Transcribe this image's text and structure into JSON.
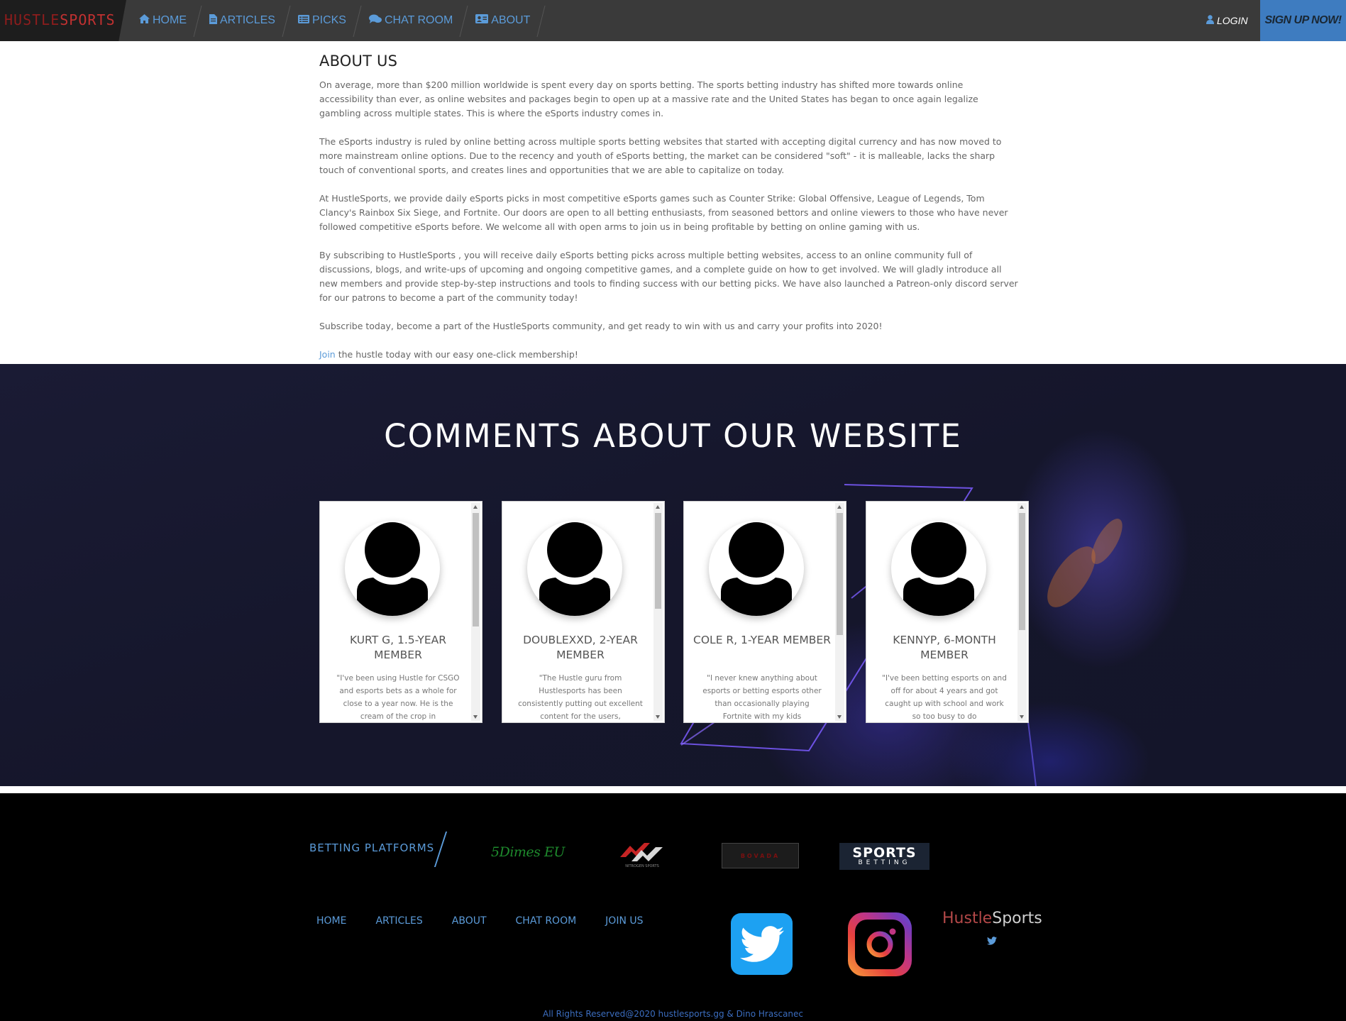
{
  "nav": {
    "brand_part1": "HUSTLE",
    "brand_part2": "SPORTS",
    "items": [
      {
        "label": "HOME",
        "icon": "home-icon"
      },
      {
        "label": "ARTICLES",
        "icon": "file-icon"
      },
      {
        "label": "PICKS",
        "icon": "list-icon"
      },
      {
        "label": "CHAT ROOM",
        "icon": "chat-icon"
      },
      {
        "label": "ABOUT",
        "icon": "id-card-icon"
      }
    ],
    "login_label": "LOGIN",
    "signup_label": "SIGN UP NOW!"
  },
  "about": {
    "title": "ABOUT US",
    "paragraphs": [
      "On average, more than $200 million worldwide is spent every day on sports betting. The sports betting industry has shifted more towards online accessibility than ever, as online websites and packages begin to open up at a massive rate and the United States has began to once again legalize gambling across multiple states. This is where the eSports industry comes in.",
      "The eSports industry is ruled by online betting across multiple sports betting websites that started with accepting digital currency and has now moved to more mainstream online options. Due to the recency and youth of eSports betting, the market can be considered \"soft\" - it is malleable, lacks the sharp touch of conventional sports, and creates lines and opportunities that we are able to capitalize on today.",
      "At HustleSports, we provide daily eSports picks in most competitive eSports games such as Counter Strike: Global Offensive, League of Legends, Tom Clancy's Rainbox Six Siege, and Fortnite. Our doors are open to all betting enthusiasts, from seasoned bettors and online viewers to those who have never followed competitive eSports before. We welcome all with open arms to join us in being profitable by betting on online gaming with us.",
      "By subscribing to HustleSports , you will receive daily eSports betting picks across multiple betting websites, access to an online community full of discussions, blogs, and write-ups of upcoming and ongoing competitive games, and a complete guide on how to get involved. We will gladly introduce all new members and provide step-by-step instructions and tools to finding success with our betting picks. We have also launched a Patreon-only discord server for our patrons to become a part of the community today!",
      "Subscribe today, become a part of the HustleSports community, and get ready to win with us and carry your profits into 2020!"
    ],
    "join_link": "Join",
    "join_rest": " the hustle today with our easy one-click membership!"
  },
  "comments": {
    "title": "COMMENTS ABOUT OUR WEBSITE",
    "cards": [
      {
        "name": "KURT G, 1.5-YEAR MEMBER",
        "quote": "\"I've been using Hustle for CSGO and esports bets as a whole for close to a year now. He is the cream of the crop in",
        "scroll_position": 0.0
      },
      {
        "name": "DOUBLEXXD, 2-YEAR MEMBER",
        "quote": "\"The Hustle guru from Hustlesports has been consistently putting out excellent content for the users,",
        "scroll_position": 0.0
      },
      {
        "name": "COLE R, 1-YEAR MEMBER",
        "quote": "\"I never knew anything about esports or betting esports other than occasionally playing Fortnite with my kids",
        "scroll_position": 0.0
      },
      {
        "name": "KENNYP, 6-MONTH MEMBER",
        "quote": "\"I've been betting esports on and off for about 4 years and got caught up with school and work so too busy to do",
        "scroll_position": 0.0
      }
    ]
  },
  "footer": {
    "betting_label": "BETTING PLATFORMS",
    "platforms": [
      "5Dimes EU",
      "NITROGEN SPORTS",
      "BOVADA",
      "SPORTS",
      "BETTING"
    ],
    "links": [
      "HOME",
      "ARTICLES",
      "ABOUT",
      "CHAT ROOM",
      "JOIN US"
    ],
    "brand_part1": "Hustle",
    "brand_part2": "Sports",
    "copyright": "All Rights Reserved@2020 hustlesports.gg & Dino Hrascanec"
  },
  "colors": {
    "nav_bg": "#3a3a3a",
    "accent_blue": "#5b9bd9",
    "signup_bg": "#3e7cc0",
    "brand_red": "#c23131",
    "comments_bg": "#15162b",
    "footer_bg": "#000000"
  }
}
